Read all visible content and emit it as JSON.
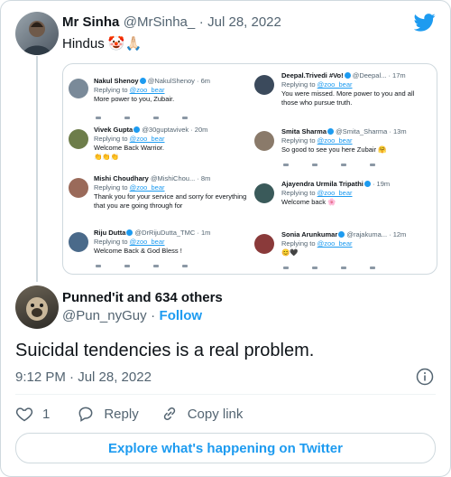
{
  "tweet": {
    "author_name": "Mr Sinha",
    "author_handle": "@MrSinha_",
    "separator": "·",
    "date": "Jul 28, 2022",
    "text": "Hindus",
    "emoji": "🤡🙏🏻"
  },
  "embedded_replies": [
    {
      "name": "Nakul Shenoy",
      "handle": "@NakulShenoy · 6m",
      "replying": "Replying to",
      "to": "@zoo_bear",
      "text": "More power to you, Zubair.",
      "avatar_color": "#7a8a99"
    },
    {
      "name": "Deepal.Trivedi #Vo!",
      "handle": "@Deepal... · 17m",
      "replying": "Replying to",
      "to": "@zoo_bear",
      "text": "You were missed. More power to you and all those who pursue truth.",
      "avatar_color": "#3b4a5c"
    },
    {
      "name": "Vivek Gupta",
      "handle": "@30guptavivek · 20m",
      "replying": "Replying to",
      "to": "@zoo_bear",
      "text": "Welcome Back Warrior.",
      "emoji": "👏👏👏",
      "avatar_color": "#6d7d4a"
    },
    {
      "name": "Smita Sharma",
      "handle": "@Smita_Sharma · 13m",
      "replying": "Replying to",
      "to": "@zoo_bear",
      "text": "So good to see you here Zubair",
      "emoji": "🤗",
      "avatar_color": "#8a7a6a"
    },
    {
      "name": "Mishi Choudhary",
      "handle": "@MishiChou... · 8m",
      "replying": "Replying to",
      "to": "@zoo_bear",
      "text": "Thank you for your service and sorry for everything that you are going through for",
      "avatar_color": "#9a6a5a"
    },
    {
      "name": "Ajayendra Urmila Tripathi",
      "handle": "· 19m",
      "replying": "Replying to",
      "to": "@zoo_bear",
      "text": "Welcome back",
      "emoji": "🌸",
      "avatar_color": "#3a5a5a"
    },
    {
      "name": "Riju Dutta",
      "handle": "@DrRijuDutta_TMC · 1m",
      "replying": "Replying to",
      "to": "@zoo_bear",
      "text": "Welcome Back & God Bless !",
      "avatar_color": "#4a6a8a"
    },
    {
      "name": "Sonia Arunkumar",
      "handle": "@rajakuma... · 12m",
      "replying": "Replying to",
      "to": "@zoo_bear",
      "text": "",
      "emoji": "😊🖤",
      "avatar_color": "#8a3a3a"
    }
  ],
  "reply": {
    "author_name": "Punned'it and 634 others",
    "author_handle": "@Pun_nyGuy",
    "separator": "·",
    "follow_label": "Follow",
    "text": "Suicidal tendencies is a real problem.",
    "time": "9:12 PM · Jul 28, 2022"
  },
  "actions": {
    "like_count": "1",
    "reply_label": "Reply",
    "copy_label": "Copy link"
  },
  "explore_label": "Explore what's happening on Twitter",
  "colors": {
    "accent": "#1d9bf0",
    "border": "#cfd9de",
    "muted": "#536471"
  }
}
